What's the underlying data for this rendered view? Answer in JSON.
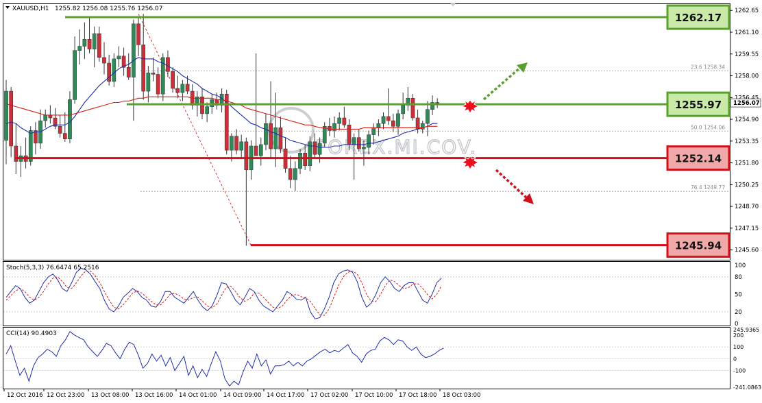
{
  "header": {
    "symbol": "XAUUSD,H1",
    "ohlc": "1255.82 1256.08 1255.76 1256.07",
    "stoch_label": "Stoch(5,3,3) 76.6474 65.2516",
    "cci_label": "CCI(14) 90.4903",
    "watermark": "FOREX.MI.COV."
  },
  "colors": {
    "bull": "#2e8b57",
    "bear": "#c8303a",
    "blue_ma": "#1f2fa8",
    "red_ma": "#d0201a",
    "green_level": "#5aa02c",
    "green_box": "#c9e9a8",
    "red_level": "#d0101a",
    "red_box": "#f0a8a8"
  },
  "chart_data": [
    {
      "type": "candlestick",
      "title": "XAUUSD,H1",
      "ylim": [
        1244.9,
        1263.1
      ],
      "price_ticks": [
        "1262.65",
        "1261.10",
        "1259.55",
        "1258.00",
        "1256.45",
        "1254.90",
        "1253.35",
        "1251.80",
        "1250.25",
        "1248.70",
        "1247.15",
        "1245.60"
      ],
      "current_price": "1256.07",
      "time_labels": [
        "12 Oct 2016",
        "12 Oct 23:00",
        "13 Oct 08:00",
        "13 Oct 16:00",
        "14 Oct 01:00",
        "14 Oct 09:00",
        "14 Oct 17:00",
        "17 Oct 02:00",
        "17 Oct 10:00",
        "17 Oct 18:00",
        "18 Oct 03:00"
      ],
      "levels": [
        {
          "value": 1262.17,
          "label": "1262.17",
          "kind": "resistance"
        },
        {
          "value": 1255.97,
          "label": "1255.97",
          "kind": "pivot"
        },
        {
          "value": 1252.14,
          "label": "1252.14",
          "kind": "support"
        },
        {
          "value": 1245.94,
          "label": "1245.94",
          "kind": "support"
        }
      ],
      "fibonacci": [
        {
          "label": "23.6  1258.34",
          "value": 1258.34
        },
        {
          "label": "50.0  1254.06",
          "value": 1254.06
        },
        {
          "label": "76.4  1249.77",
          "value": 1249.77
        }
      ],
      "candles_ohlc": [
        [
          1253.4,
          1257.7,
          1251.7,
          1256.9
        ],
        [
          1256.9,
          1257.2,
          1252.2,
          1253.0
        ],
        [
          1253.0,
          1254.6,
          1251.0,
          1251.9
        ],
        [
          1251.9,
          1253.0,
          1250.8,
          1252.3
        ],
        [
          1252.3,
          1253.6,
          1251.4,
          1251.9
        ],
        [
          1251.9,
          1254.4,
          1251.6,
          1254.1
        ],
        [
          1254.1,
          1254.7,
          1252.4,
          1253.2
        ],
        [
          1253.2,
          1255.6,
          1252.8,
          1254.8
        ],
        [
          1254.8,
          1255.6,
          1254.3,
          1255.2
        ],
        [
          1255.2,
          1255.9,
          1254.6,
          1255.0
        ],
        [
          1255.0,
          1255.7,
          1254.2,
          1254.4
        ],
        [
          1254.4,
          1255.2,
          1253.6,
          1253.9
        ],
        [
          1253.9,
          1255.4,
          1253.3,
          1253.5
        ],
        [
          1253.5,
          1256.9,
          1253.2,
          1256.3
        ],
        [
          1256.3,
          1260.8,
          1256.0,
          1259.8
        ],
        [
          1259.8,
          1261.3,
          1258.8,
          1260.1
        ],
        [
          1260.1,
          1261.8,
          1259.2,
          1260.6
        ],
        [
          1260.6,
          1262.1,
          1259.6,
          1259.9
        ],
        [
          1259.9,
          1261.5,
          1258.6,
          1261.0
        ],
        [
          1261.0,
          1261.5,
          1259.0,
          1259.3
        ],
        [
          1259.3,
          1260.4,
          1258.1,
          1258.9
        ],
        [
          1258.9,
          1259.5,
          1257.3,
          1257.6
        ],
        [
          1257.6,
          1259.6,
          1257.2,
          1259.2
        ],
        [
          1259.2,
          1260.1,
          1258.6,
          1259.4
        ],
        [
          1259.4,
          1260.0,
          1258.0,
          1258.6
        ],
        [
          1258.6,
          1259.6,
          1257.7,
          1257.9
        ],
        [
          1257.9,
          1262.0,
          1254.8,
          1261.7
        ],
        [
          1261.7,
          1262.1,
          1259.4,
          1260.2
        ],
        [
          1260.2,
          1262.4,
          1256.3,
          1256.9
        ],
        [
          1256.9,
          1258.7,
          1256.1,
          1258.2
        ],
        [
          1258.2,
          1259.3,
          1257.6,
          1258.1
        ],
        [
          1258.1,
          1258.6,
          1256.4,
          1256.7
        ],
        [
          1256.7,
          1259.6,
          1256.2,
          1259.3
        ],
        [
          1259.3,
          1259.8,
          1257.9,
          1258.3
        ],
        [
          1258.3,
          1258.6,
          1256.8,
          1257.1
        ],
        [
          1257.1,
          1258.0,
          1256.4,
          1256.8
        ],
        [
          1256.8,
          1257.7,
          1256.2,
          1257.4
        ],
        [
          1257.4,
          1258.0,
          1256.7,
          1256.9
        ],
        [
          1256.9,
          1257.4,
          1255.6,
          1255.9
        ],
        [
          1255.9,
          1256.9,
          1255.1,
          1256.5
        ],
        [
          1256.5,
          1257.1,
          1254.9,
          1255.3
        ],
        [
          1255.3,
          1256.1,
          1254.7,
          1255.8
        ],
        [
          1255.8,
          1256.7,
          1255.3,
          1256.3
        ],
        [
          1256.3,
          1256.8,
          1255.6,
          1255.9
        ],
        [
          1255.9,
          1257.1,
          1255.4,
          1256.7
        ],
        [
          1256.7,
          1257.0,
          1252.4,
          1252.7
        ],
        [
          1252.7,
          1253.9,
          1251.9,
          1253.7
        ],
        [
          1253.7,
          1254.2,
          1252.4,
          1252.7
        ],
        [
          1252.7,
          1253.8,
          1252.1,
          1253.3
        ],
        [
          1253.3,
          1253.6,
          1245.9,
          1251.3
        ],
        [
          1251.3,
          1253.4,
          1250.6,
          1253.0
        ],
        [
          1253.0,
          1259.6,
          1252.3,
          1252.3
        ],
        [
          1252.3,
          1253.6,
          1251.6,
          1253.1
        ],
        [
          1253.1,
          1255.3,
          1252.7,
          1254.6
        ],
        [
          1254.6,
          1257.6,
          1252.1,
          1252.8
        ],
        [
          1252.8,
          1256.8,
          1251.5,
          1254.3
        ],
        [
          1254.3,
          1255.1,
          1252.5,
          1252.8
        ],
        [
          1252.8,
          1253.6,
          1251.1,
          1251.4
        ],
        [
          1251.4,
          1252.3,
          1250.0,
          1250.6
        ],
        [
          1250.6,
          1251.9,
          1249.8,
          1251.4
        ],
        [
          1251.4,
          1252.8,
          1251.0,
          1252.5
        ],
        [
          1252.5,
          1253.1,
          1251.3,
          1251.6
        ],
        [
          1251.6,
          1253.7,
          1251.2,
          1253.3
        ],
        [
          1253.3,
          1253.9,
          1252.1,
          1252.4
        ],
        [
          1252.4,
          1253.6,
          1251.8,
          1253.2
        ],
        [
          1253.2,
          1254.7,
          1252.9,
          1254.4
        ],
        [
          1254.4,
          1255.0,
          1253.7,
          1254.1
        ],
        [
          1254.1,
          1255.1,
          1253.6,
          1254.6
        ],
        [
          1254.6,
          1255.4,
          1254.1,
          1255.0
        ],
        [
          1255.0,
          1255.8,
          1254.3,
          1254.5
        ],
        [
          1254.5,
          1254.9,
          1252.7,
          1253.1
        ],
        [
          1253.1,
          1253.9,
          1250.6,
          1253.6
        ],
        [
          1253.6,
          1254.2,
          1252.6,
          1252.8
        ],
        [
          1252.8,
          1253.4,
          1251.6,
          1252.9
        ],
        [
          1252.9,
          1254.1,
          1252.4,
          1253.8
        ],
        [
          1253.8,
          1254.6,
          1253.1,
          1254.3
        ],
        [
          1254.3,
          1254.9,
          1253.7,
          1254.6
        ],
        [
          1254.6,
          1255.4,
          1254.2,
          1255.1
        ],
        [
          1255.1,
          1257.1,
          1254.5,
          1254.8
        ],
        [
          1254.8,
          1255.3,
          1254.0,
          1254.4
        ],
        [
          1254.4,
          1255.6,
          1253.8,
          1255.3
        ],
        [
          1255.3,
          1256.8,
          1254.9,
          1255.9
        ],
        [
          1255.9,
          1257.2,
          1255.5,
          1256.4
        ],
        [
          1256.4,
          1256.7,
          1254.8,
          1255.0
        ],
        [
          1255.0,
          1255.6,
          1253.9,
          1254.2
        ],
        [
          1254.2,
          1254.8,
          1253.9,
          1254.6
        ],
        [
          1254.6,
          1256.2,
          1253.7,
          1255.6
        ],
        [
          1255.6,
          1256.6,
          1255.2,
          1256.1
        ],
        [
          1256.1,
          1256.4,
          1255.7,
          1256.07
        ]
      ],
      "series": [
        {
          "name": "blue_ma",
          "values": [
            1254.6,
            1254.7,
            1254.6,
            1254.3,
            1254.1,
            1253.9,
            1254.0,
            1254.0,
            1254.2,
            1254.4,
            1254.5,
            1254.5,
            1254.5,
            1254.7,
            1255.1,
            1255.6,
            1256.1,
            1256.5,
            1256.9,
            1257.3,
            1257.6,
            1257.9,
            1258.2,
            1258.5,
            1258.7,
            1258.8,
            1259.1,
            1259.3,
            1259.2,
            1259.2,
            1259.2,
            1259.0,
            1258.9,
            1258.7,
            1258.5,
            1258.3,
            1258.0,
            1257.8,
            1257.6,
            1257.4,
            1257.1,
            1256.9,
            1256.7,
            1256.6,
            1256.4,
            1256.1,
            1255.8,
            1255.5,
            1255.2,
            1254.9,
            1254.6,
            1254.5,
            1254.3,
            1254.2,
            1254.0,
            1253.9,
            1253.7,
            1253.6,
            1253.4,
            1253.3,
            1253.2,
            1253.1,
            1253.0,
            1253.0,
            1252.9,
            1252.9,
            1252.9,
            1253.0,
            1253.0,
            1253.1,
            1253.1,
            1253.1,
            1253.1,
            1253.1,
            1253.2,
            1253.2,
            1253.3,
            1253.4,
            1253.5,
            1253.6,
            1253.7,
            1253.9,
            1254.0,
            1254.1,
            1254.2,
            1254.3,
            1254.4,
            1254.6,
            1254.6
          ]
        },
        {
          "name": "red_ma",
          "values": [
            1256.0,
            1255.9,
            1255.8,
            1255.7,
            1255.6,
            1255.5,
            1255.4,
            1255.3,
            1255.2,
            1255.2,
            1255.2,
            1255.2,
            1255.2,
            1255.2,
            1255.3,
            1255.4,
            1255.5,
            1255.6,
            1255.7,
            1255.8,
            1255.9,
            1256.0,
            1256.1,
            1256.1,
            1256.2,
            1256.2,
            1256.3,
            1256.4,
            1256.4,
            1256.5,
            1256.5,
            1256.5,
            1256.5,
            1256.5,
            1256.5,
            1256.5,
            1256.5,
            1256.5,
            1256.4,
            1256.4,
            1256.4,
            1256.4,
            1256.4,
            1256.3,
            1256.3,
            1256.2,
            1256.1,
            1256.0,
            1255.9,
            1255.7,
            1255.6,
            1255.5,
            1255.4,
            1255.3,
            1255.2,
            1255.1,
            1255.0,
            1254.9,
            1254.8,
            1254.7,
            1254.6,
            1254.5,
            1254.5,
            1254.4,
            1254.3,
            1254.3,
            1254.2,
            1254.2,
            1254.2,
            1254.2,
            1254.2,
            1254.2,
            1254.2,
            1254.3,
            1254.3,
            1254.3,
            1254.3,
            1254.3,
            1254.3,
            1254.3,
            1254.3,
            1254.3,
            1254.3,
            1254.3,
            1254.3,
            1254.3,
            1254.4,
            1254.4,
            1254.4
          ]
        }
      ]
    },
    {
      "type": "line",
      "title": "Stoch(5,3,3) 76.6474 65.2516",
      "ylim": [
        0,
        100
      ],
      "y_ticks": [
        "100",
        "80",
        "50",
        "20",
        "0"
      ],
      "series": [
        {
          "name": "main",
          "values": [
            45,
            55,
            65,
            60,
            45,
            35,
            40,
            55,
            70,
            80,
            85,
            75,
            60,
            55,
            70,
            88,
            95,
            92,
            85,
            72,
            60,
            40,
            25,
            20,
            30,
            45,
            52,
            60,
            55,
            45,
            40,
            30,
            28,
            38,
            55,
            55,
            45,
            40,
            35,
            45,
            55,
            40,
            28,
            22,
            30,
            48,
            70,
            68,
            55,
            40,
            32,
            45,
            60,
            55,
            40,
            30,
            25,
            20,
            30,
            40,
            55,
            50,
            42,
            40,
            45,
            20,
            8,
            10,
            25,
            45,
            70,
            85,
            90,
            92,
            88,
            72,
            45,
            28,
            35,
            50,
            70,
            80,
            72,
            60,
            55,
            65,
            70,
            70,
            55,
            40,
            35,
            50,
            70,
            78
          ]
        },
        {
          "name": "signal",
          "values": [
            40,
            48,
            56,
            60,
            55,
            45,
            40,
            45,
            55,
            68,
            78,
            80,
            72,
            62,
            60,
            70,
            82,
            90,
            90,
            82,
            70,
            55,
            40,
            28,
            25,
            32,
            42,
            52,
            56,
            52,
            45,
            38,
            32,
            32,
            40,
            50,
            52,
            48,
            42,
            40,
            45,
            45,
            38,
            30,
            27,
            33,
            48,
            62,
            64,
            55,
            44,
            38,
            42,
            52,
            52,
            45,
            36,
            28,
            26,
            30,
            40,
            48,
            50,
            46,
            44,
            38,
            26,
            15,
            14,
            25,
            45,
            65,
            80,
            88,
            90,
            85,
            70,
            50,
            38,
            38,
            50,
            65,
            75,
            72,
            65,
            60,
            62,
            68,
            68,
            60,
            50,
            42,
            50,
            65
          ]
        }
      ]
    },
    {
      "type": "line",
      "title": "CCI(14) 90.4903",
      "ylim": [
        -241.0863,
        245.9365
      ],
      "y_ticks": [
        "245.9365",
        "200",
        "100",
        "0",
        "-100",
        "-241.0863"
      ],
      "series": [
        {
          "name": "CCI",
          "values": [
            40,
            110,
            -20,
            -140,
            -80,
            -190,
            -60,
            10,
            40,
            80,
            60,
            20,
            110,
            160,
            230,
            200,
            180,
            160,
            100,
            60,
            20,
            70,
            130,
            110,
            50,
            0,
            80,
            140,
            120,
            30,
            -80,
            -40,
            40,
            -20,
            30,
            -60,
            10,
            -100,
            -40,
            20,
            -140,
            -60,
            -160,
            -90,
            -150,
            -40,
            60,
            -20,
            -170,
            -230,
            -190,
            -220,
            -110,
            -20,
            -80,
            40,
            -60,
            -10,
            -130,
            -60,
            -60,
            -50,
            -20,
            -60,
            -30,
            -60,
            -20,
            0,
            30,
            60,
            80,
            50,
            70,
            60,
            90,
            120,
            50,
            20,
            -30,
            40,
            70,
            80,
            150,
            180,
            160,
            120,
            160,
            150,
            100,
            70,
            100,
            40,
            10,
            20,
            40,
            70,
            90
          ]
        }
      ]
    }
  ]
}
